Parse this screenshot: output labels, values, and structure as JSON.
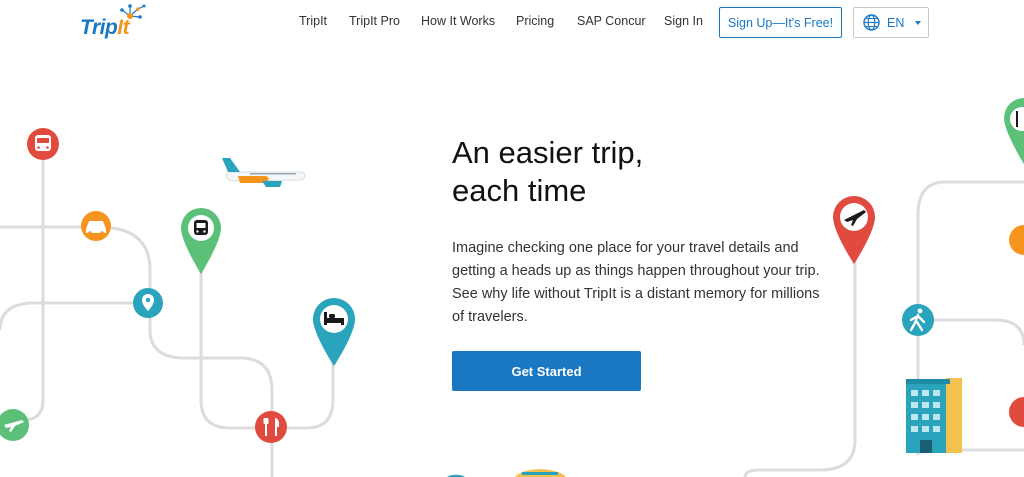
{
  "brand": {
    "logo_text_a": "Trip",
    "logo_text_b": "It",
    "logo_color": "#1a78c2",
    "logo_accent": "#f7941d"
  },
  "nav": {
    "items": [
      {
        "label": "TripIt"
      },
      {
        "label": "TripIt Pro"
      },
      {
        "label": "How It Works"
      },
      {
        "label": "Pricing"
      },
      {
        "label": "SAP Concur"
      },
      {
        "label": "Sign In"
      }
    ],
    "signup_label": "Sign Up—It's Free!",
    "language": "EN"
  },
  "hero": {
    "title_line1": "An easier trip,",
    "title_line2": "each time",
    "body": "Imagine checking one place for your travel details and getting a heads up as things happen throughout your trip. See why life without TripIt is a distant memory for millions of travelers.",
    "cta_label": "Get Started"
  },
  "colors": {
    "accent": "#1a78c2",
    "red": "#e04a3f",
    "green": "#5cc078",
    "teal": "#2aa3bd",
    "orange": "#f7941d",
    "road": "#dcdcdc"
  },
  "icons": [
    "bus-icon",
    "car-icon",
    "train-icon",
    "map-pin-icon",
    "hotel-bed-icon",
    "restaurant-icon",
    "airplane-icon",
    "walking-icon",
    "building-icon"
  ]
}
